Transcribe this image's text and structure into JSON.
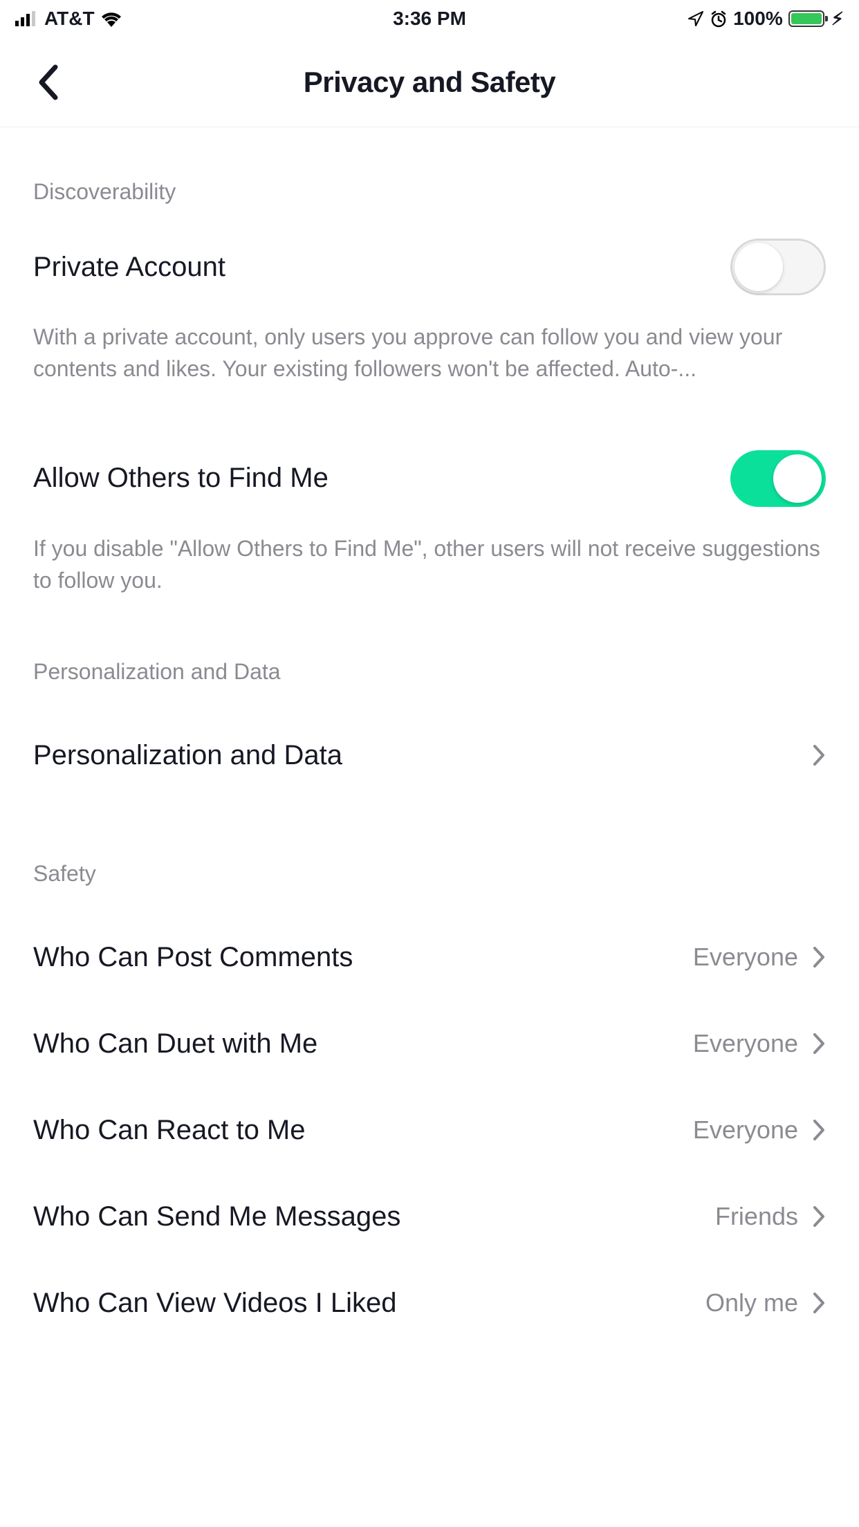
{
  "status": {
    "carrier": "AT&T",
    "time": "3:36 PM",
    "battery": "100%"
  },
  "header": {
    "title": "Privacy and Safety"
  },
  "sections": {
    "discoverability": {
      "header": "Discoverability",
      "private_account": {
        "label": "Private Account",
        "enabled": false,
        "description": "With a private account, only users you approve can follow you and view your contents and likes. Your existing followers won't be affected. Auto-..."
      },
      "allow_find": {
        "label": "Allow Others to Find Me",
        "enabled": true,
        "description": "If you disable \"Allow Others to Find Me\", other users will not receive suggestions to follow you."
      }
    },
    "personalization": {
      "header": "Personalization and Data",
      "row_label": "Personalization and Data"
    },
    "safety": {
      "header": "Safety",
      "rows": [
        {
          "label": "Who Can Post Comments",
          "value": "Everyone"
        },
        {
          "label": "Who Can Duet with Me",
          "value": "Everyone"
        },
        {
          "label": "Who Can React to Me",
          "value": "Everyone"
        },
        {
          "label": "Who Can Send Me Messages",
          "value": "Friends"
        },
        {
          "label": "Who Can View Videos I Liked",
          "value": "Only me"
        }
      ]
    }
  }
}
